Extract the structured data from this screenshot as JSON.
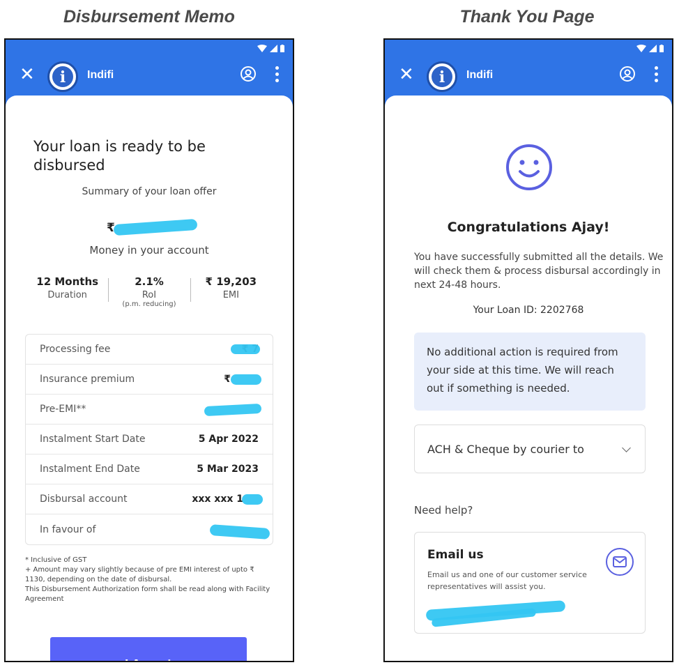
{
  "captions": {
    "left": "Disbursement Memo",
    "right": "Thank You Page"
  },
  "app": {
    "name": "Indifi",
    "logo_letter": "i"
  },
  "memo": {
    "title": "Your loan is ready to be disbursed",
    "summary": "Summary of your loan offer",
    "amount_prefix": "₹",
    "money_label": "Money in your account",
    "stats": [
      {
        "value": "12 Months",
        "label": "Duration",
        "sub": ""
      },
      {
        "value": "2.1%",
        "label": "RoI",
        "sub": "(p.m. reducing)"
      },
      {
        "value": "₹ 19,203",
        "label": "EMI",
        "sub": ""
      }
    ],
    "fees": [
      {
        "label": "Processing fee",
        "value": "₹ 7"
      },
      {
        "label": "Insurance premium",
        "value": "₹"
      },
      {
        "label": "Pre-EMI**",
        "value": ""
      },
      {
        "label": "Instalment Start Date",
        "value": "5 Apr 2022"
      },
      {
        "label": "Instalment End Date",
        "value": "5 Mar 2023"
      },
      {
        "label": "Disbursal account",
        "value": "xxx xxx 1"
      },
      {
        "label": "In favour of",
        "value": ""
      }
    ],
    "footnotes": [
      "* Inclusive of GST",
      "+ Amount may vary slightly because of pre EMI interest of upto ₹ 1130, depending on the date of disbursal.",
      "This Disbursement Authorization form shall be read along with Facility Agreement"
    ],
    "accept_label": "I Accept"
  },
  "thanks": {
    "congrats": "Congratulations Ajay!",
    "submitted": "You have successfully submitted all the details. We will check them & process disbursal accordingly in next 24-48 hours.",
    "loan_id": "Your Loan ID: 2202768",
    "info": "No additional action is required from your side at this time. We will reach out if something is needed.",
    "courier_label": "ACH & Cheque by courier to",
    "need_help": "Need help?",
    "email_title": "Email us",
    "email_desc": "Email us and one of our customer service representatives will assist you."
  },
  "colors": {
    "app_bar": "#2f74e6",
    "accept_button": "#5863f8",
    "redaction": "#34c6f2",
    "info_box": "#e8eefb",
    "smiley": "#5a60e0"
  },
  "icons": [
    "close-icon",
    "account-icon",
    "more-vert-icon",
    "wifi-icon",
    "signal-icon",
    "battery-icon",
    "smiley-icon",
    "chevron-down-icon",
    "mail-icon"
  ]
}
